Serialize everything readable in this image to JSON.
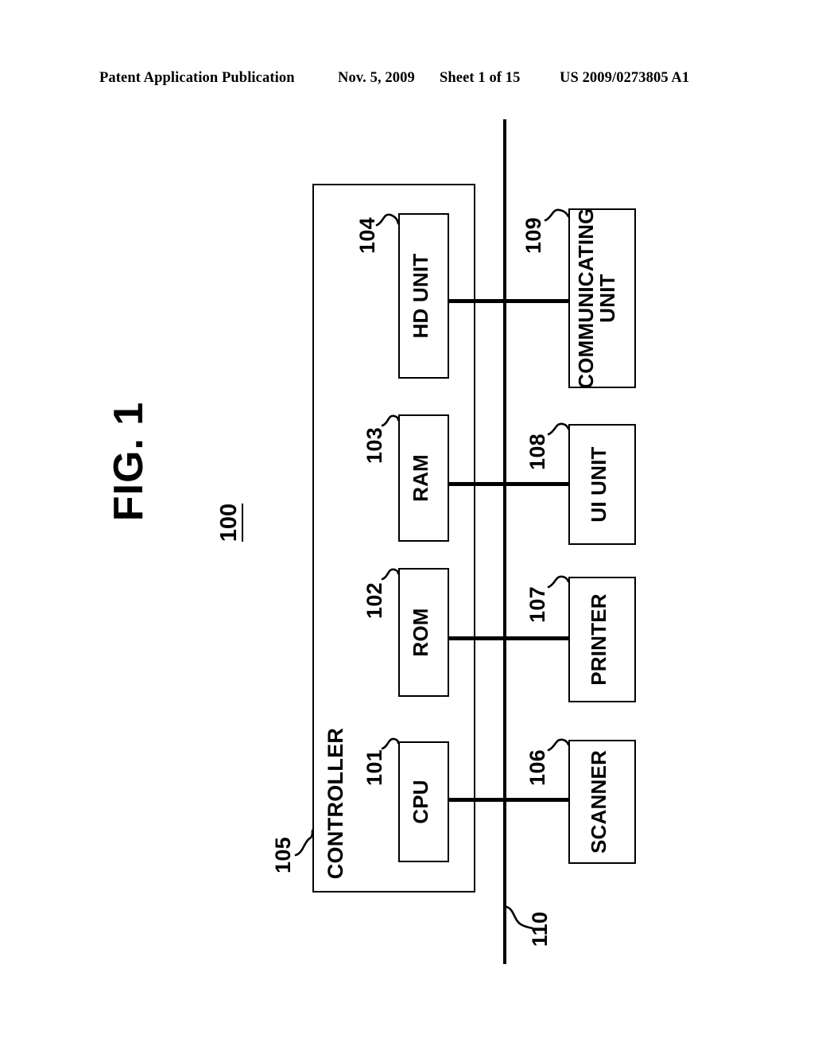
{
  "header": {
    "publication": "Patent Application Publication",
    "date": "Nov. 5, 2009",
    "sheet": "Sheet 1 of 15",
    "patent_number": "US 2009/0273805 A1"
  },
  "figure": {
    "title": "FIG. 1",
    "system_ref": "100",
    "controller_label": "CONTROLLER",
    "controller_ref": "105",
    "bus_ref": "110",
    "internal_units": [
      {
        "label": "CPU",
        "ref": "101"
      },
      {
        "label": "ROM",
        "ref": "102"
      },
      {
        "label": "RAM",
        "ref": "103"
      },
      {
        "label": "HD UNIT",
        "ref": "104"
      }
    ],
    "peripheral_units": [
      {
        "label": "SCANNER",
        "ref": "106",
        "line2": ""
      },
      {
        "label": "PRINTER",
        "ref": "107",
        "line2": ""
      },
      {
        "label": "UI UNIT",
        "ref": "108",
        "line2": ""
      },
      {
        "label": "COMMUNICATING",
        "ref": "109",
        "line2": "UNIT"
      }
    ]
  },
  "colors": {
    "ink": "#000000",
    "paper": "#ffffff"
  }
}
